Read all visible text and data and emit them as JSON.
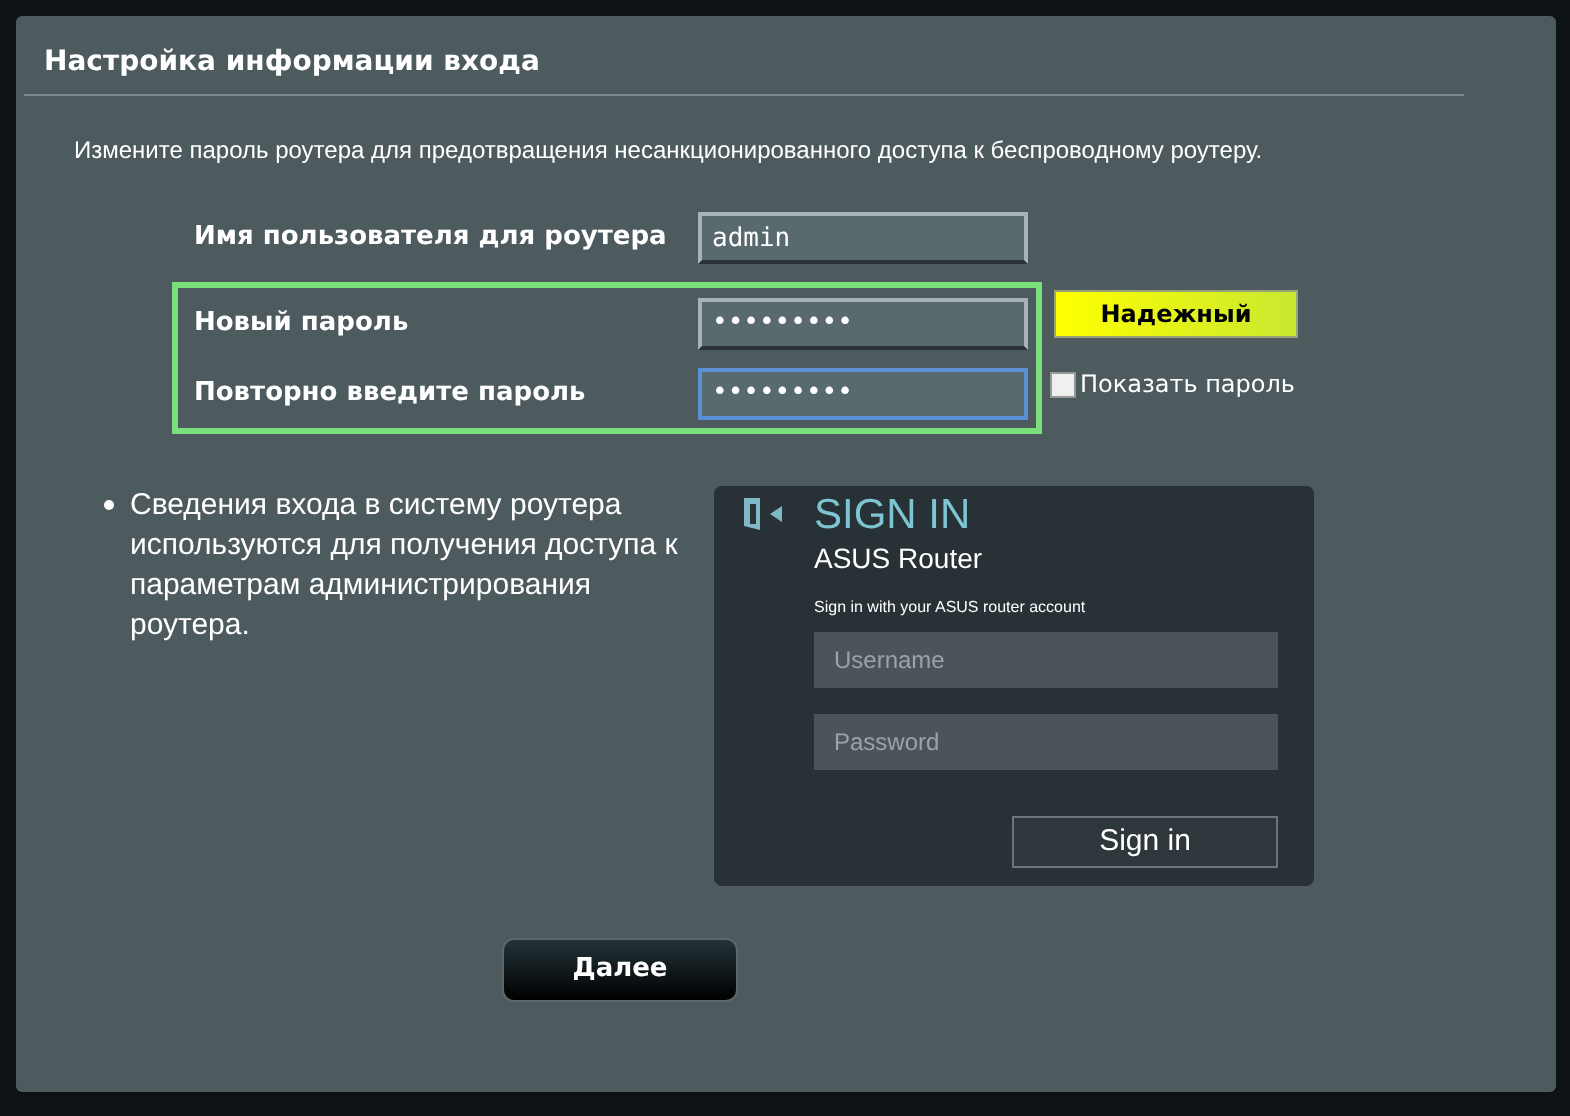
{
  "panel": {
    "title": "Настройка информации входа",
    "description": "Измените пароль роутера для предотвращения несанкционированного доступа к беспроводному роутеру."
  },
  "fields": [
    {
      "label": "Имя пользователя для роутера",
      "value": "admin",
      "highlighted": false,
      "focused": false
    },
    {
      "label": "Новый пароль",
      "value": "•••••••••",
      "highlighted": true,
      "focused": false
    },
    {
      "label": "Повторно введите пароль",
      "value": "•••••••••",
      "highlighted": true,
      "focused": true
    }
  ],
  "strength": {
    "label": "Надежный"
  },
  "show_password": {
    "label": "Показать пароль",
    "checked": false
  },
  "note": "Сведения входа в систему роутера используются для получения доступа к параметрам администрирования роутера.",
  "sign_in_preview": {
    "title": "SIGN IN",
    "subtitle": "ASUS Router",
    "hint": "Sign in with your ASUS router account",
    "username_placeholder": "Username",
    "password_placeholder": "Password",
    "button": "Sign in"
  },
  "next_button": "Далее"
}
